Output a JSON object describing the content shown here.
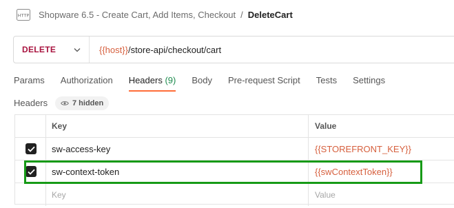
{
  "breadcrumb": {
    "icon": "http-request-icon",
    "parent": "Shopware 6.5 - Create Cart, Add Items, Checkout",
    "separator": "/",
    "current": "DeleteCart"
  },
  "request": {
    "method": "DELETE",
    "url_var": "{{host}}",
    "url_path": "/store-api/checkout/cart"
  },
  "tabs": [
    {
      "label": "Params"
    },
    {
      "label": "Authorization"
    },
    {
      "label": "Headers",
      "count": "(9)",
      "active": true
    },
    {
      "label": "Body"
    },
    {
      "label": "Pre-request Script"
    },
    {
      "label": "Tests"
    },
    {
      "label": "Settings"
    }
  ],
  "headers_section": {
    "label": "Headers",
    "hidden_badge": "7 hidden"
  },
  "table": {
    "columns": {
      "key": "Key",
      "value": "Value"
    },
    "rows": [
      {
        "key": "sw-access-key",
        "value": "{{STOREFRONT_KEY}}",
        "checked": true
      },
      {
        "key": "sw-context-token",
        "value": "{{swContextToken}}",
        "checked": true
      }
    ],
    "placeholder": {
      "key": "Key",
      "value": "Value"
    }
  },
  "colors": {
    "method": "#a8123e",
    "variable": "#d65f3d",
    "active_tab_underline": "#ff6c37",
    "tab_count": "#1b8a4c",
    "highlight": "#169a16"
  }
}
